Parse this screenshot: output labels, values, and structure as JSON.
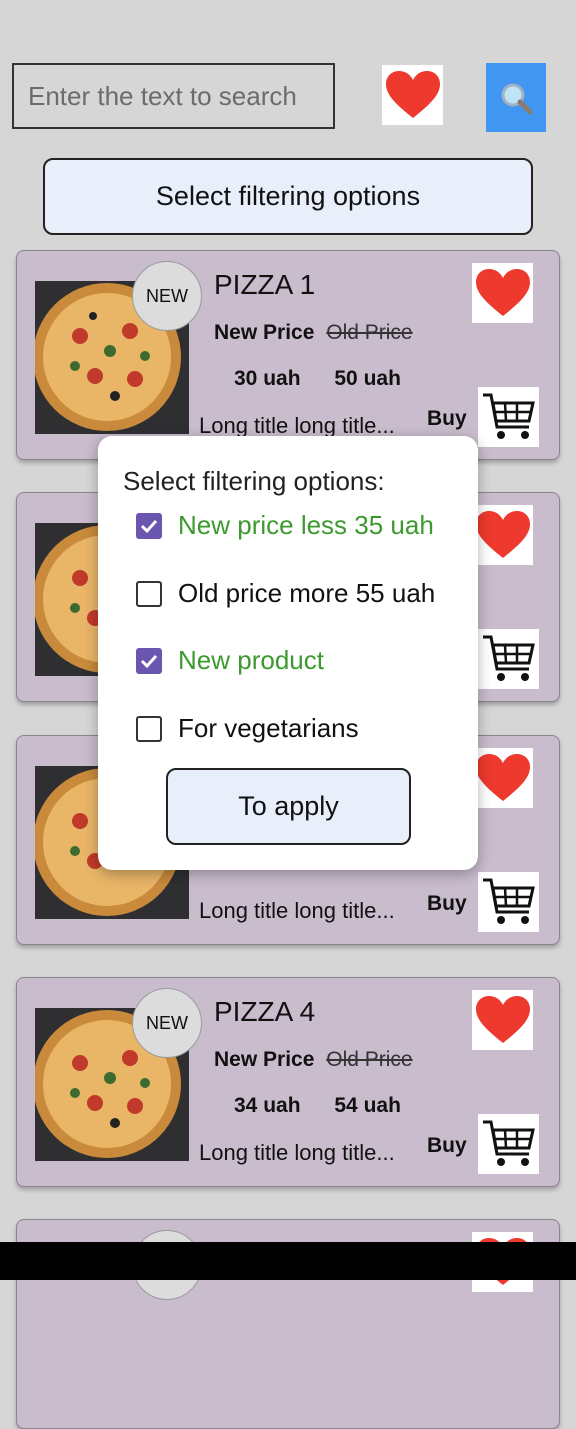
{
  "search": {
    "placeholder": "Enter the text to search"
  },
  "icons": {
    "favorite": "heart-icon",
    "search": "magnifier-icon",
    "cart": "cart-icon"
  },
  "colors": {
    "accent": "#4096f0",
    "card_bg": "#c9bccd",
    "heart": "#ee3a2e",
    "check": "#6a55b0",
    "checked_text": "#3c9a2e"
  },
  "filter_button": {
    "label": "Select filtering options"
  },
  "cards": [
    {
      "badge": "NEW",
      "title": "PIZZA 1",
      "new_price_label": "New Price",
      "old_price_label": "Old Price",
      "new_price": "30 uah",
      "old_price": "50 uah",
      "description": "Long title long title...",
      "buy_label": "Buy"
    },
    {
      "badge": "",
      "title": "",
      "new_price_label": "",
      "old_price_label": "",
      "new_price": "",
      "old_price": "",
      "description": "",
      "buy_label": ""
    },
    {
      "badge": "",
      "title": "",
      "new_price_label": "",
      "old_price_label": "",
      "new_price": "",
      "old_price": "",
      "description": "Long title long title...",
      "buy_label": "Buy"
    },
    {
      "badge": "NEW",
      "title": "PIZZA 4",
      "new_price_label": "New Price",
      "old_price_label": "Old Price",
      "new_price": "34 uah",
      "old_price": "54 uah",
      "description": "Long title long title...",
      "buy_label": "Buy"
    }
  ],
  "filter_dialog": {
    "title": "Select filtering options:",
    "options": [
      {
        "label": "New price less 35 uah",
        "checked": true
      },
      {
        "label": "Old price more 55 uah",
        "checked": false
      },
      {
        "label": "New product",
        "checked": true
      },
      {
        "label": "For vegetarians",
        "checked": false
      }
    ],
    "apply_label": "To apply"
  }
}
